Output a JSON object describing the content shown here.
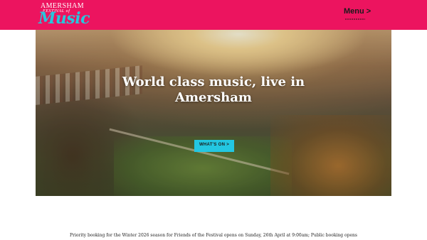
{
  "header": {
    "background": "#ec145f",
    "logo": {
      "line1": "AMERSHAM",
      "line2": "FESTIVAL of",
      "line3": "Music",
      "accent": "#27c6dd"
    },
    "menu": {
      "label": "Menu >"
    }
  },
  "hero": {
    "title": "World class music, live in Amersham",
    "cta": {
      "label": "WHAT'S ON >",
      "color": "#23c7e2"
    }
  },
  "notice": {
    "text": "Priority booking for the Winter 2026 season for Friends of the Festival opens on Sunday, 26th April at 9:00am; Public booking opens"
  }
}
